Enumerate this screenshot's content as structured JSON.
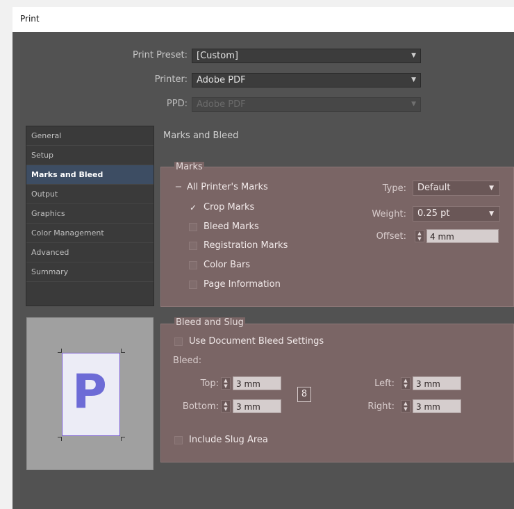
{
  "window": {
    "title": "Print"
  },
  "preset": {
    "print_preset_label": "Print Preset:",
    "print_preset_value": "[Custom]",
    "printer_label": "Printer:",
    "printer_value": "Adobe PDF",
    "ppd_label": "PPD:",
    "ppd_value": "Adobe PDF"
  },
  "sidebar": {
    "items": [
      {
        "label": "General"
      },
      {
        "label": "Setup"
      },
      {
        "label": "Marks and Bleed"
      },
      {
        "label": "Output"
      },
      {
        "label": "Graphics"
      },
      {
        "label": "Color Management"
      },
      {
        "label": "Advanced"
      },
      {
        "label": "Summary"
      }
    ],
    "active": "Marks and Bleed"
  },
  "section_title": "Marks and Bleed",
  "marks": {
    "group_label": "Marks",
    "all_marks_label": "All Printer's Marks",
    "crop_marks": {
      "label": "Crop Marks",
      "checked": true
    },
    "bleed_marks": {
      "label": "Bleed Marks",
      "checked": false
    },
    "registration_marks": {
      "label": "Registration Marks",
      "checked": false
    },
    "color_bars": {
      "label": "Color Bars",
      "checked": false
    },
    "page_information": {
      "label": "Page Information",
      "checked": false
    },
    "type_label": "Type:",
    "type_value": "Default",
    "weight_label": "Weight:",
    "weight_value": "0.25 pt",
    "offset_label": "Offset:",
    "offset_value": "4 mm"
  },
  "bleed": {
    "group_label": "Bleed and Slug",
    "use_doc_bleed": {
      "label": "Use Document Bleed Settings",
      "checked": false
    },
    "bleed_label": "Bleed:",
    "top_label": "Top:",
    "top_value": "3 mm",
    "bottom_label": "Bottom:",
    "bottom_value": "3 mm",
    "left_label": "Left:",
    "left_value": "3 mm",
    "right_label": "Right:",
    "right_value": "3 mm",
    "link_icon_glyph": "8",
    "include_slug": {
      "label": "Include Slug Area",
      "checked": false
    }
  },
  "preview": {
    "page_glyph": "P"
  },
  "colors": {
    "dialog_bg": "#525252",
    "panel_bg": "#7a6565",
    "active_item_bg": "#3d4d63",
    "preview_page_accent": "#6d6bd6"
  }
}
